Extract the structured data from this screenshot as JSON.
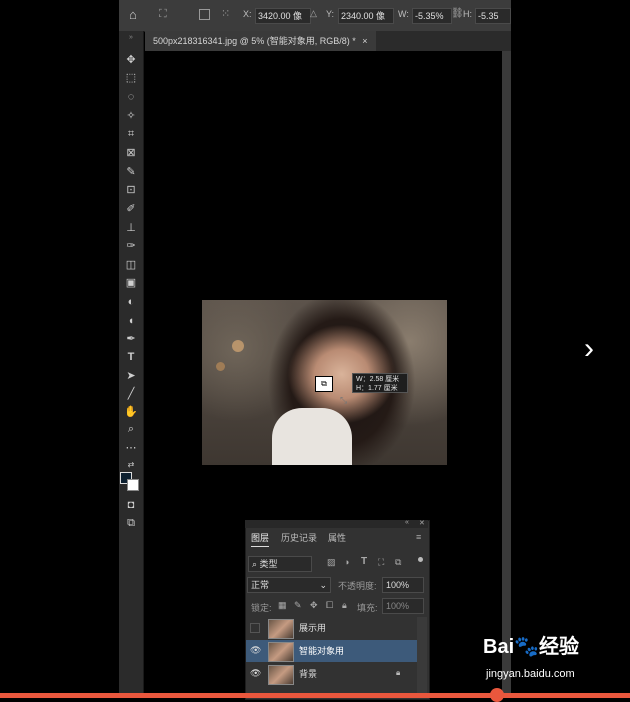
{
  "options_bar": {
    "x_label": "X:",
    "x_value": "3420.00 像",
    "y_label": "Y:",
    "y_value": "2340.00 像",
    "w_label": "W:",
    "w_value": "-5.35%",
    "h_label": "H:",
    "h_value": "-5.35"
  },
  "document_tab": {
    "title": "500px218316341.jpg @ 5% (智能对象用, RGB/8) *",
    "close": "×"
  },
  "tooltip": {
    "w_line": "W：2.58 厘米",
    "h_line": "H：1.77 厘米"
  },
  "tools": [
    "move-icon",
    "marquee-icon",
    "lasso-icon",
    "magic-wand-icon",
    "crop-icon",
    "frame-icon",
    "eyedropper-icon",
    "healing-icon",
    "brush-icon",
    "stamp-icon",
    "history-brush-icon",
    "eraser-icon",
    "gradient-icon",
    "blur-icon",
    "dodge-icon",
    "pen-icon",
    "type-icon",
    "path-select-icon",
    "line-icon",
    "hand-icon",
    "zoom-icon",
    "more-icon"
  ],
  "tool_type_glyph": "T",
  "layers_panel": {
    "tabs": [
      "图层",
      "历史记录",
      "属性"
    ],
    "filter_label": "类型",
    "blend_mode": "正常",
    "opacity_label": "不透明度:",
    "opacity_value": "100%",
    "lock_label": "锁定:",
    "fill_label": "填充:",
    "fill_value": "100%",
    "layers": [
      {
        "name": "展示用",
        "visible": false,
        "selected": false,
        "locked": false
      },
      {
        "name": "智能对象用",
        "visible": true,
        "selected": true,
        "locked": false
      },
      {
        "name": "背景",
        "visible": true,
        "selected": false,
        "locked": true
      }
    ]
  },
  "watermark": {
    "brand": "Bai🐾经验",
    "url": "jingyan.baidu.com"
  },
  "colors": {
    "accent": "#e9573d",
    "selected_layer": "#3d5a7a"
  }
}
